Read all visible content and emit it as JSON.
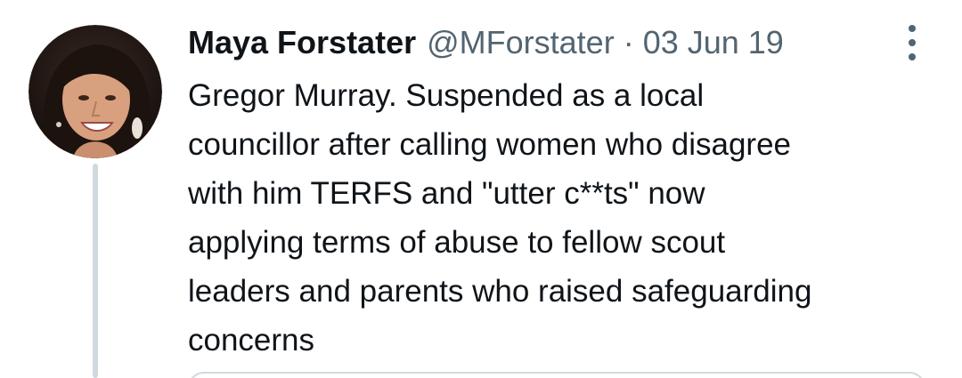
{
  "tweet": {
    "author": {
      "display_name": "Maya Forstater",
      "handle": "@MForstater",
      "avatar_icon": "profile-photo"
    },
    "separator": "·",
    "date": "03 Jun 19",
    "more_icon": "more-options-icon",
    "text_lines": [
      "Gregor Murray. Suspended as a local",
      "councillor after calling women who disagree",
      "with him TERFS and \"utter c**ts\" now",
      "applying terms of abuse to fellow scout",
      "leaders and parents who raised safeguarding",
      "concerns"
    ]
  },
  "colors": {
    "text_primary": "#0f1419",
    "text_secondary": "#536471",
    "thread_line": "#cfd9de",
    "background": "#ffffff"
  }
}
